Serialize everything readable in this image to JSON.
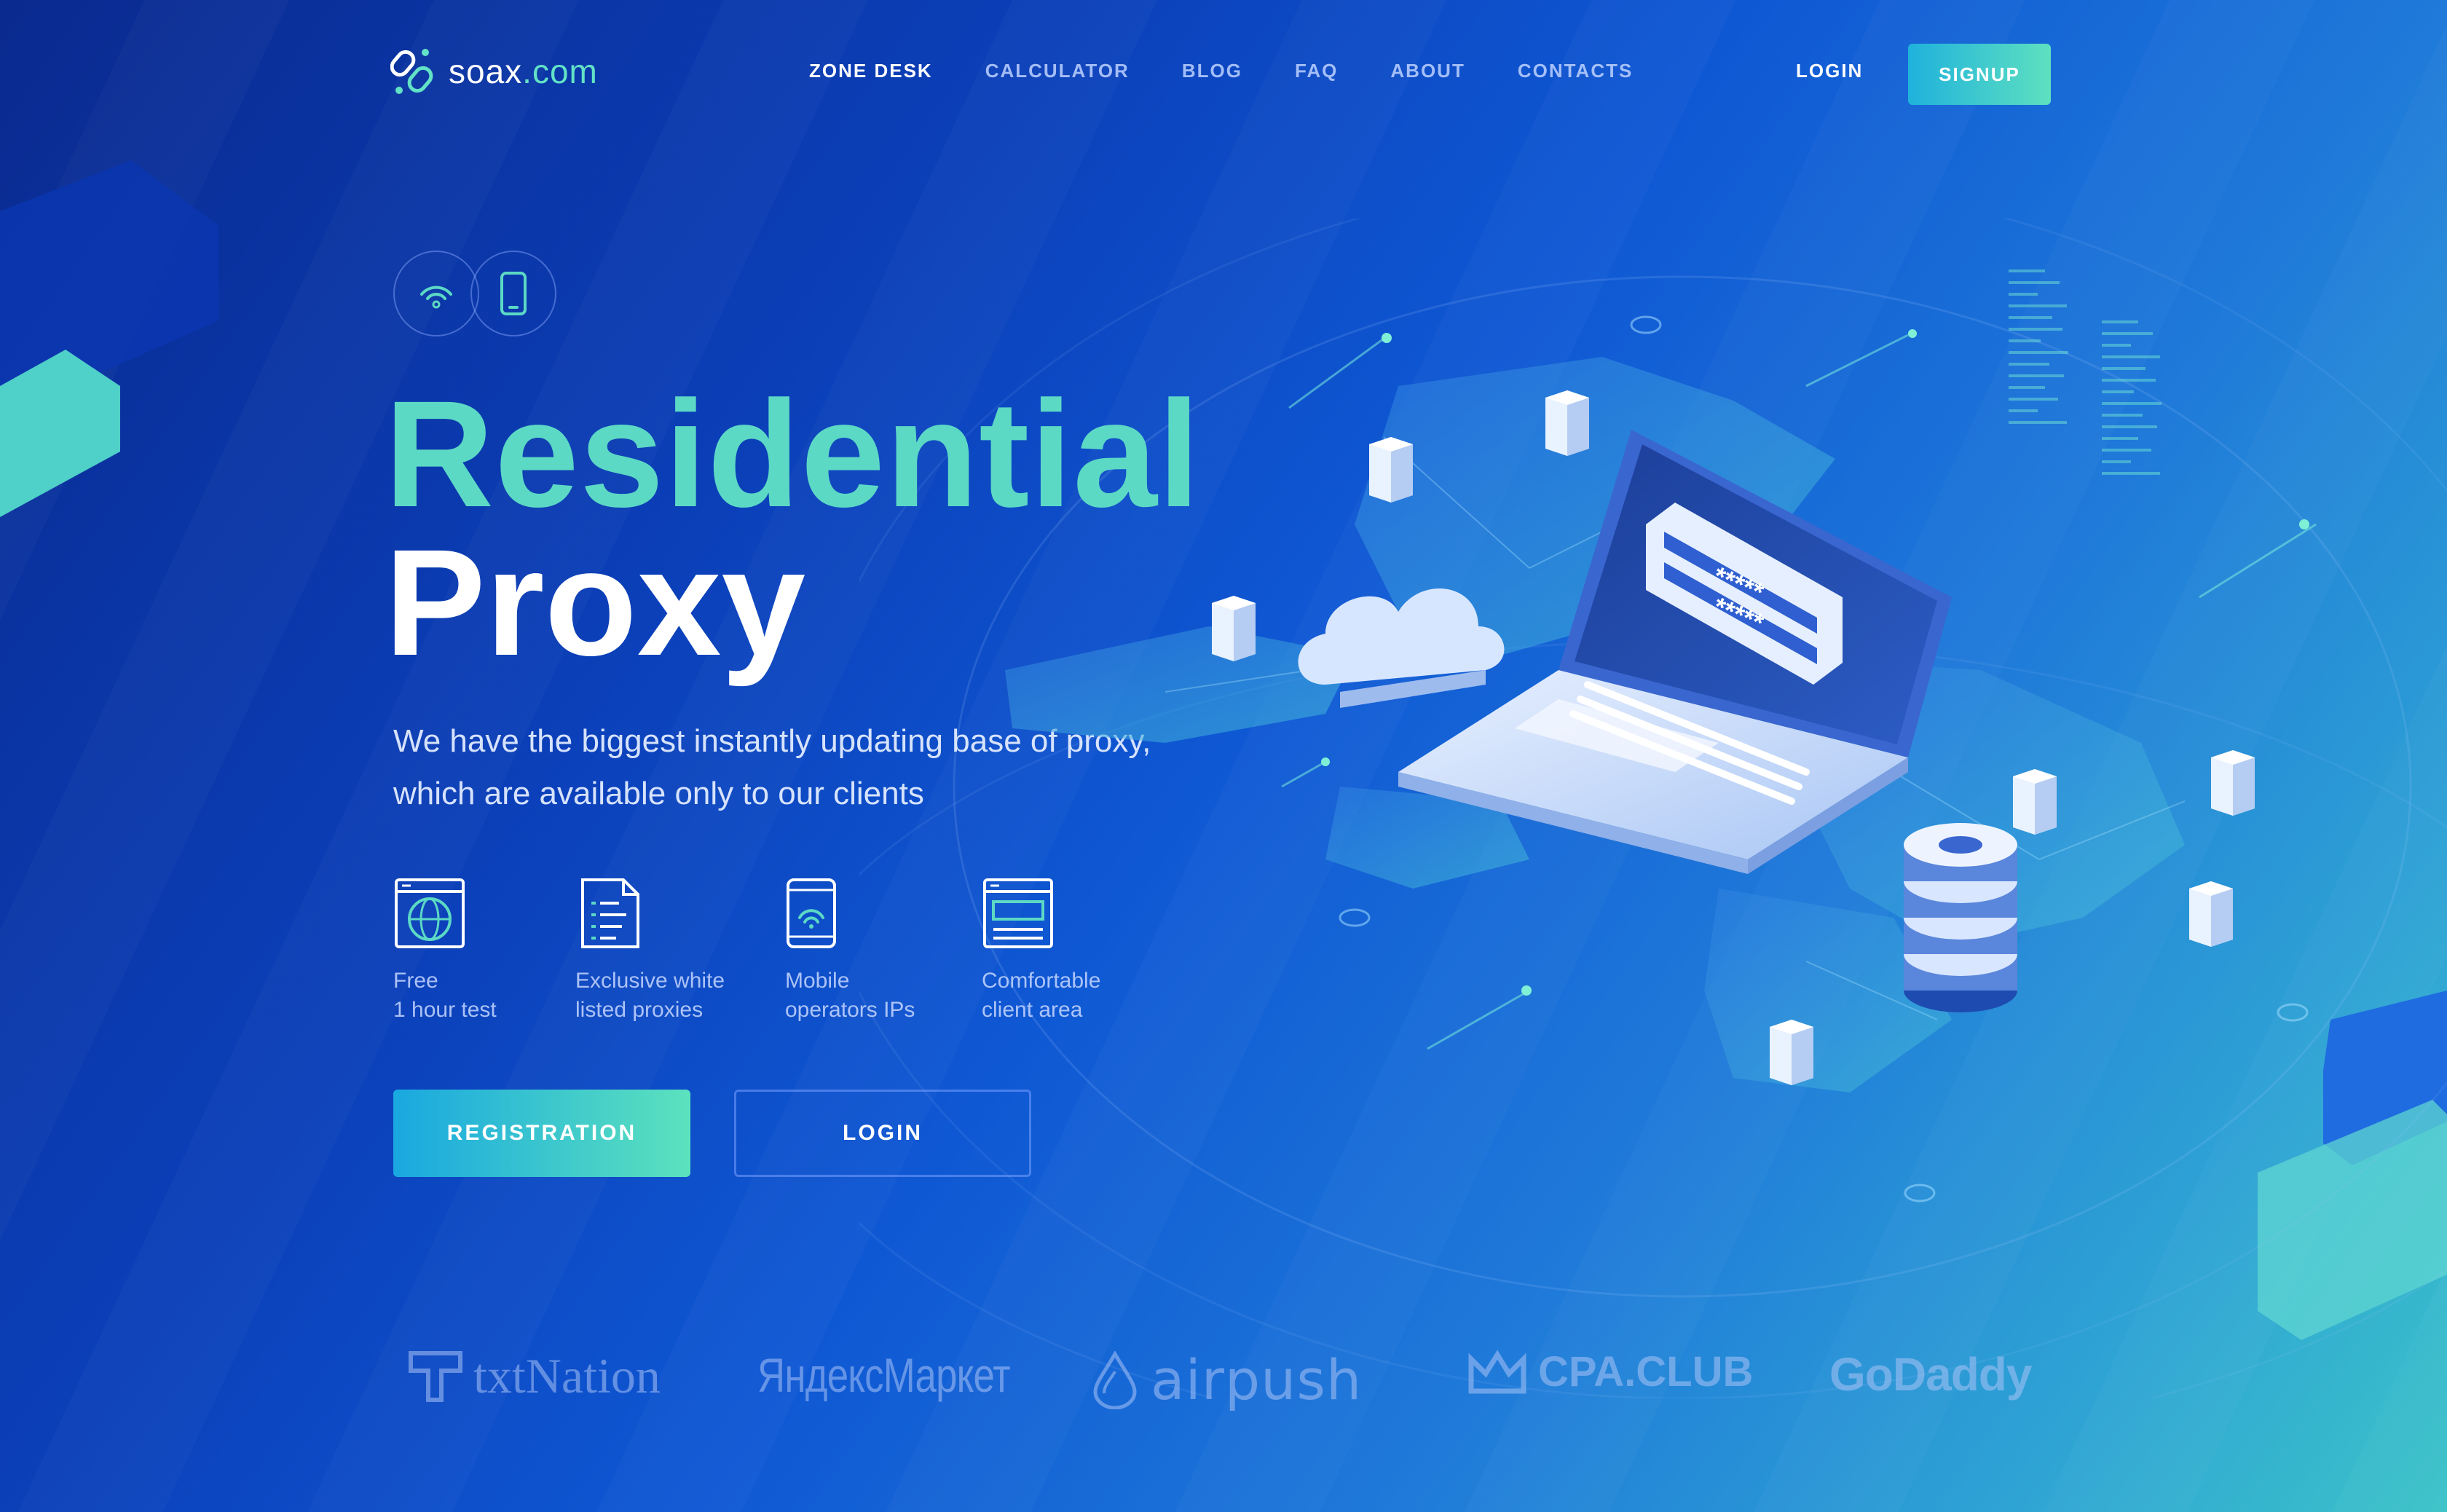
{
  "header": {
    "brand": "soax",
    "brand_suffix": ".com",
    "nav": [
      "ZONE DESK",
      "CALCULATOR",
      "BLOG",
      "FAQ",
      "ABOUT",
      "CONTACTS"
    ],
    "nav_active": "ZONE DESK",
    "login_label": "LOGIN",
    "signup_label": "SIGNUP"
  },
  "hero": {
    "title_line1": "Residential",
    "title_line2": "Proxy",
    "lead": "We have the biggest instantly updating base of proxy, which are available only to our clients",
    "badges": [
      "wifi-icon",
      "phone-icon"
    ],
    "features": [
      {
        "icon": "globe-window-icon",
        "label": "Free\n1 hour test"
      },
      {
        "icon": "document-list-icon",
        "label": "Exclusive white\nlisted proxies"
      },
      {
        "icon": "mobile-signal-icon",
        "label": "Mobile\noperators IPs"
      },
      {
        "icon": "browser-window-icon",
        "label": "Comfortable\nclient area"
      }
    ],
    "registration_label": "REGISTRATION",
    "login_label": "LOGIN"
  },
  "illustration": {
    "password_fields": [
      "*****",
      "*****"
    ]
  },
  "partners": [
    "txtNation",
    "ЯндексМаркет",
    "airpush",
    "CPA.CLUB",
    "GoDaddy"
  ],
  "colors": {
    "accent_teal": "#5cd9c5",
    "bg_deep": "#0a2a8f",
    "bg_light": "#3cc3c8"
  }
}
